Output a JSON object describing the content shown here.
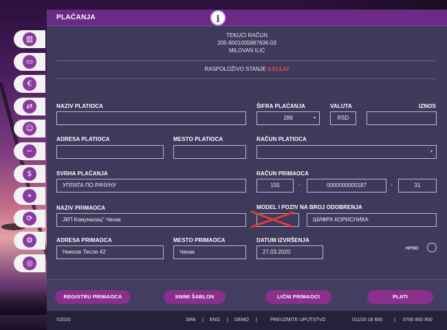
{
  "header": {
    "title": "PLAĆANJA",
    "info_icon": "i"
  },
  "sidebar": {
    "items": [
      {
        "icon": "chart-icon",
        "glyph": "▥"
      },
      {
        "icon": "card-icon",
        "glyph": "▭"
      },
      {
        "icon": "euro-hand-icon",
        "glyph": "€"
      },
      {
        "icon": "exchange-icon",
        "glyph": "⇄"
      },
      {
        "icon": "users-icon",
        "glyph": "☺"
      },
      {
        "icon": "card-minus-icon",
        "glyph": "−"
      },
      {
        "icon": "dollar-icon",
        "glyph": "$"
      },
      {
        "icon": "location-icon",
        "glyph": "⌖"
      },
      {
        "icon": "currency-exchange-icon",
        "glyph": "⟳"
      },
      {
        "icon": "settings-icon",
        "glyph": "⚙"
      },
      {
        "icon": "target-icon",
        "glyph": "◎"
      }
    ]
  },
  "account": {
    "type": "TEKUĆI RAČUN",
    "number": "205-9001005887606-03",
    "owner": "MILOVAN ILIĆ"
  },
  "balance": {
    "label": "RASPOLOŽIVO STANJE",
    "amount": "8.013,47",
    "amount_color": "#e94a4a"
  },
  "form": {
    "naziv_platioca": {
      "label": "NAZIV PLATIOCA",
      "value": ""
    },
    "adresa_platioca": {
      "label": "ADRESA PLATIOCA",
      "value": ""
    },
    "mesto_platioca": {
      "label": "MESTO PLATIOCA",
      "value": ""
    },
    "svrha_placanja": {
      "label": "SVRHA PLAĆANJA",
      "value": "УПЛАТА ПО РАЧУНУ"
    },
    "naziv_primaoca": {
      "label": "NAZIV PRIMAOCA",
      "value": "ЈКП Комуналац\" Чачак"
    },
    "adresa_primaoca": {
      "label": "ADRESA PRIMAOCA",
      "value": "Николе Тесле  42"
    },
    "mesto_primaoca": {
      "label": "MESTO PRIMAOCA",
      "value": "Чачак"
    },
    "sifra_placanja": {
      "label": "ŠIFRA PLAĆANJA",
      "value": "289"
    },
    "valuta": {
      "label": "VALUTA",
      "value": "RSD"
    },
    "iznos": {
      "label": "IZNOS",
      "value": ""
    },
    "racun_platioca": {
      "label": "RAČUN PLATIOCA",
      "value": ""
    },
    "racun_primaoca": {
      "label": "RAČUN PRIMAOCA",
      "bank": "155",
      "account": "0000000000187",
      "control": "31"
    },
    "model_poziv": {
      "label": "MODEL I POZIV NA BROJ ODOBRENJA",
      "model": "",
      "reference": "ШИФРА КОРИСНИКА"
    },
    "datum_izvrsenja": {
      "label": "DATUM IZVRŠENJA",
      "value": "27.03.2020"
    },
    "hitno": {
      "label": "HITNO"
    },
    "separator": "-"
  },
  "actions": {
    "registar": "REGISTRU PRIMAOCA",
    "snimi_sablon": "SNIMI ŠABLON",
    "licni_primaoci": "LIČNI PRIMAOCI",
    "plati": "PLATI"
  },
  "footer": {
    "copyright": "©2020",
    "lang_srb": "SRB",
    "sep": "|",
    "lang_eng": "ENG",
    "demo": "DEMO",
    "uputstvo": "PREUZMITE UPUTSTVO",
    "phone1": "011/20 18 600",
    "phone2": "0700 800 900"
  }
}
